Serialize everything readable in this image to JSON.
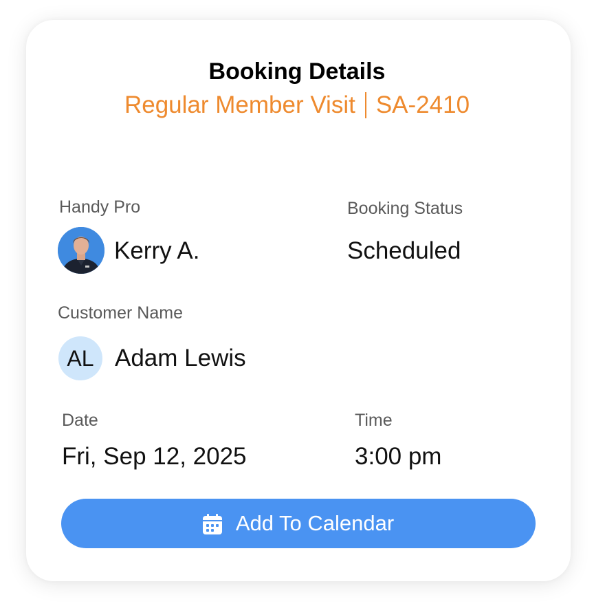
{
  "header": {
    "title": "Booking Details",
    "subtitle_left": "Regular Member Visit",
    "subtitle_right": "SA-2410"
  },
  "handy_pro": {
    "label": "Handy Pro",
    "name": "Kerry A."
  },
  "booking_status": {
    "label": "Booking Status",
    "value": "Scheduled"
  },
  "customer": {
    "label": "Customer Name",
    "initials": "AL",
    "name": "Adam Lewis"
  },
  "date": {
    "label": "Date",
    "value": "Fri, Sep 12, 2025"
  },
  "time": {
    "label": "Time",
    "value": "3:00 pm"
  },
  "action": {
    "label": "Add To Calendar",
    "icon": "calendar-icon"
  },
  "colors": {
    "accent": "#ee8a2e",
    "button": "#4a93f2",
    "initials_bg": "#cfe6fb"
  }
}
